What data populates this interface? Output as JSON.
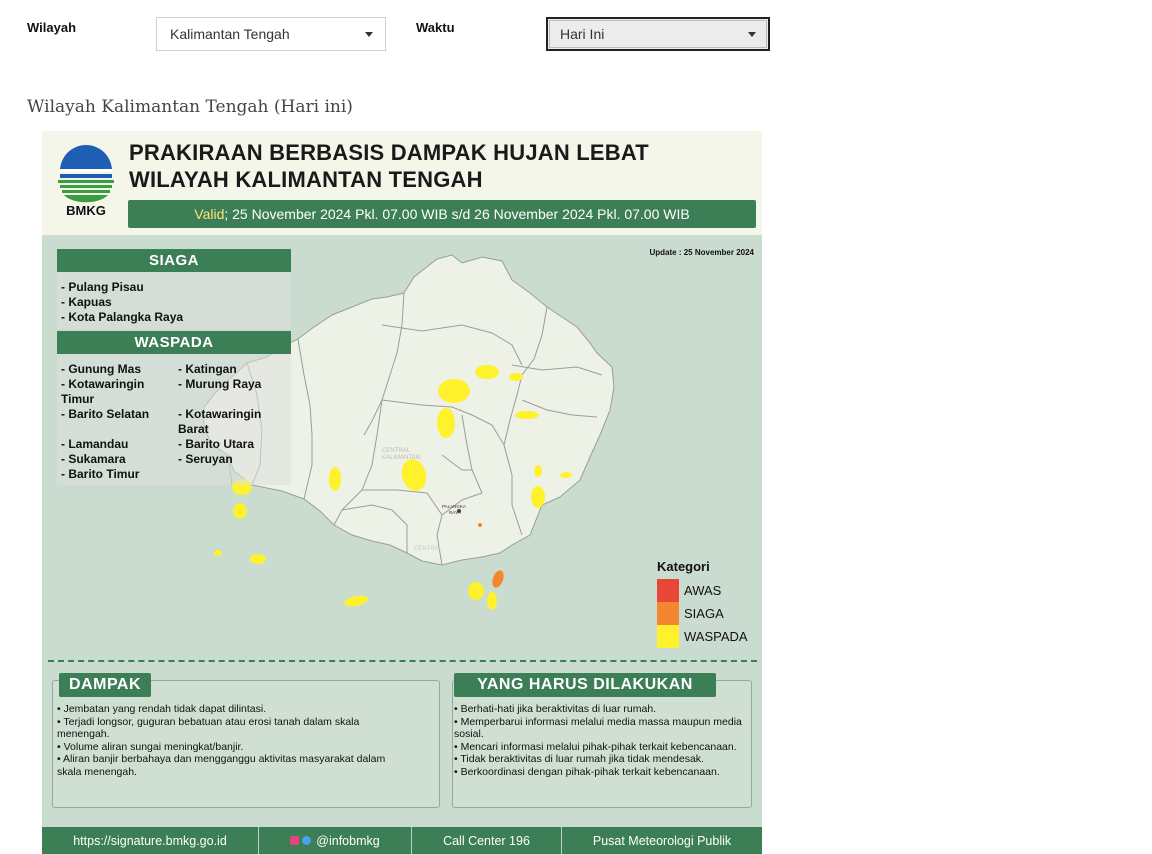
{
  "filters": {
    "wilayah_label": "Wilayah",
    "wilayah_value": "Kalimantan Tengah",
    "waktu_label": "Waktu",
    "waktu_value": "Hari Ini"
  },
  "section_title": "Wilayah Kalimantan Tengah (Hari ini)",
  "infographic": {
    "logo_text": "BMKG",
    "title_line1": "PRAKIRAAN BERBASIS DAMPAK HUJAN LEBAT",
    "title_line2": "WILAYAH KALIMANTAN TENGAH",
    "valid_label": "Valid",
    "valid_range": "; 25 November 2024 Pkl. 07.00 WIB s/d 26 November 2024 Pkl. 07.00 WIB",
    "update": "Update : 25 November 2024",
    "map_label_region": "CENTRAL\nKALIMANTAN",
    "map_label_city": "PALANGKA\nRAYA",
    "siaga": {
      "title": "SIAGA",
      "items": [
        "- Pulang Pisau",
        "- Kapuas",
        "- Kota Palangka Raya"
      ]
    },
    "waspada": {
      "title": "WASPADA",
      "col1": [
        "- Gunung Mas",
        "- Kotawaringin\nTimur",
        "- Barito Selatan",
        "",
        "- Lamandau",
        "- Sukamara",
        "- Barito Timur"
      ],
      "col2": [
        "- Katingan",
        "- Murung Raya",
        "",
        "- Kotawaringin\nBarat",
        "- Barito Utara",
        "- Seruyan"
      ]
    },
    "kategori": {
      "title": "Kategori",
      "items": [
        {
          "label": "AWAS",
          "color": "#e84637"
        },
        {
          "label": "SIAGA",
          "color": "#f3862f"
        },
        {
          "label": "WASPADA",
          "color": "#fff12b"
        }
      ]
    },
    "dampak": {
      "title": "DAMPAK",
      "text": "• Jembatan yang rendah tidak dapat dilintasi.\n• Terjadi longsor, guguran bebatuan atau erosi tanah dalam skala menengah.\n• Volume aliran sungai meningkat/banjir.\n• Aliran banjir berbahaya dan mengganggu aktivitas masyarakat dalam skala menengah."
    },
    "harus": {
      "title": "YANG HARUS DILAKUKAN",
      "text": "• Berhati-hati jika beraktivitas di luar rumah.\n• Memperbarui informasi melalui media massa maupun media sosial.\n• Mencari informasi melalui pihak-pihak terkait kebencanaan.\n• Tidak beraktivitas di luar rumah jika tidak mendesak.\n• Berkoordinasi dengan pihak-pihak terkait kebencanaan."
    },
    "footer": {
      "website": "https://signature.bmkg.go.id",
      "social": "@infobmkg",
      "call": "Call Center 196",
      "org": "Pusat Meteorologi Publik"
    },
    "colors": {
      "green": "#3c7e55",
      "map_bg": "#c9dccf",
      "land": "#eef1e6",
      "header_bg": "#f4f6ea"
    }
  }
}
